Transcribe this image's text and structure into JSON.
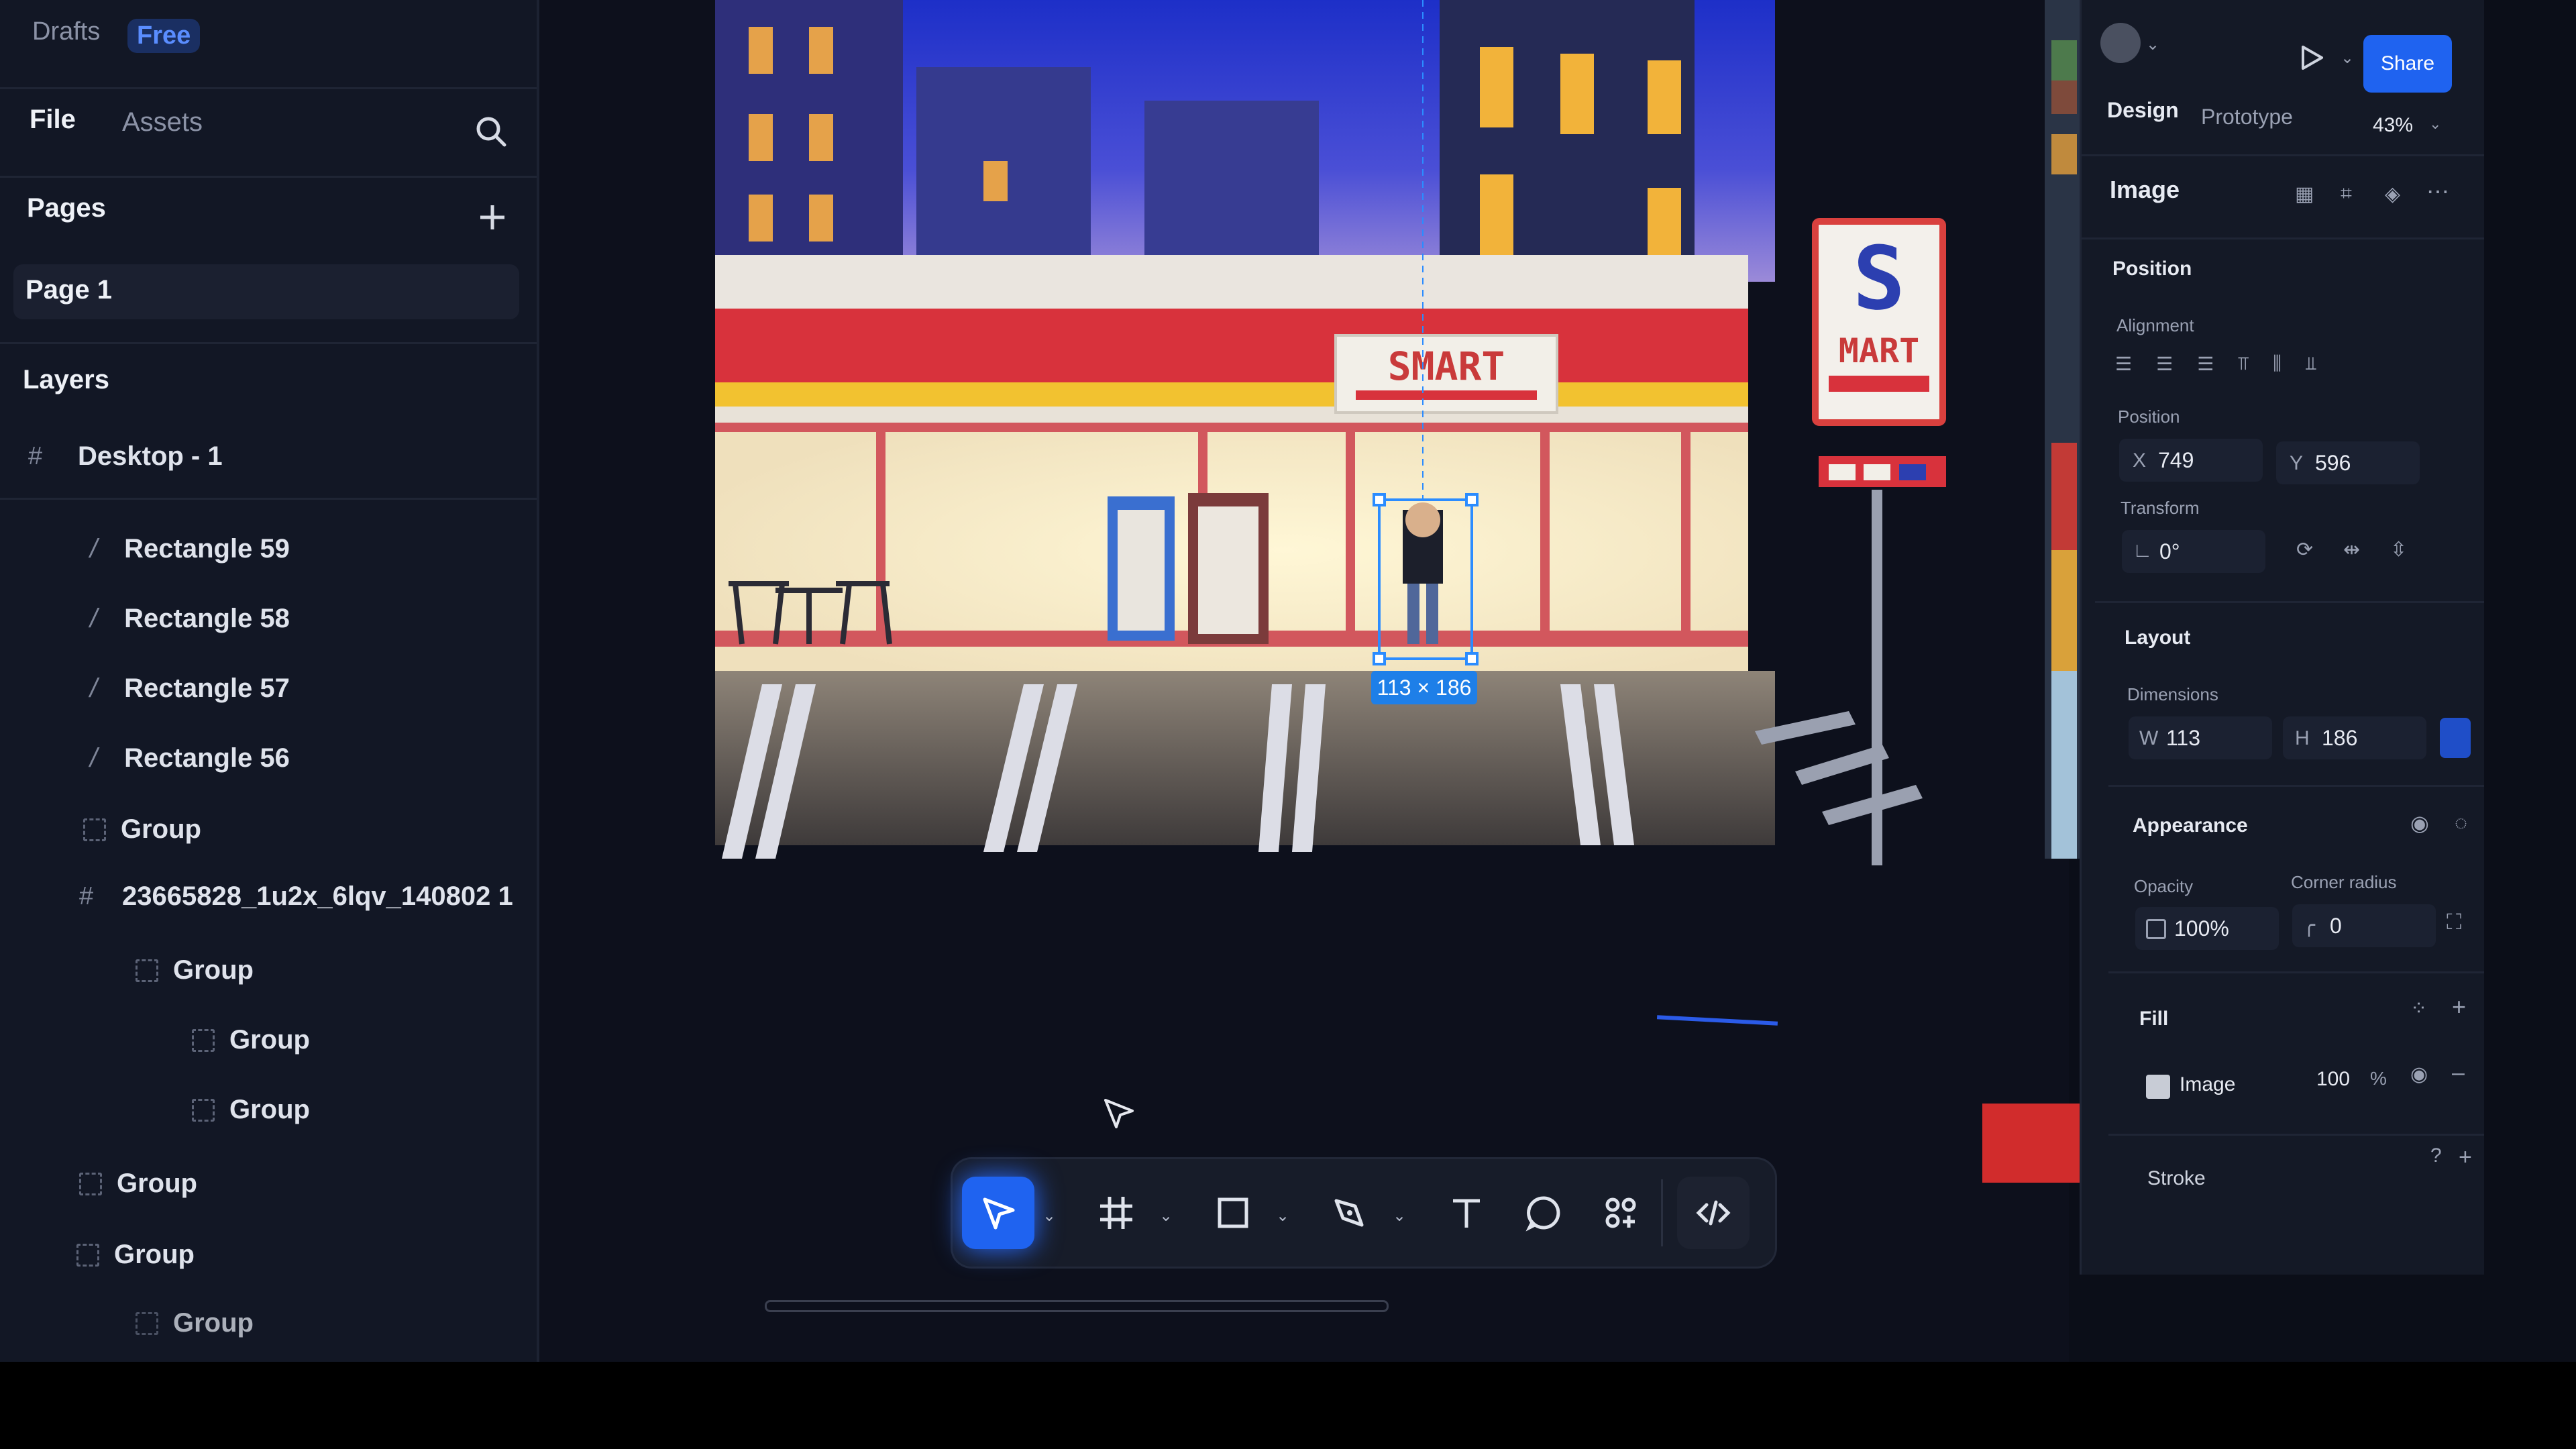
{
  "top": {
    "drafts": "Drafts",
    "plan_badge": "Free"
  },
  "left_tabs": {
    "file": "File",
    "assets": "Assets"
  },
  "pages": {
    "title": "Pages",
    "items": [
      "Page 1"
    ]
  },
  "layers": {
    "title": "Layers",
    "frame": "Desktop - 1",
    "items": [
      "Rectangle 59",
      "Rectangle 58",
      "Rectangle 57",
      "Rectangle 56",
      "Group",
      "23665828_1u2x_6lqv_140802 1",
      "Group",
      "Group",
      "Group",
      "Group",
      "Group",
      "Group"
    ]
  },
  "canvas": {
    "store_sign": "SMART",
    "pole_sign_s": "S",
    "pole_sign_text": "MART",
    "selection_size": "113 × 186"
  },
  "right": {
    "share": "Share",
    "tabs": {
      "design": "Design",
      "prototype": "Prototype"
    },
    "zoom": "43%",
    "section_title": "Image",
    "position": {
      "title": "Position",
      "alignment_label": "Alignment",
      "position_label": "Position",
      "x_label": "X",
      "x": "749",
      "y_label": "Y",
      "y": "596",
      "transform_label": "Transform",
      "rotation": "0°"
    },
    "layout": {
      "title": "Layout",
      "dimensions_label": "Dimensions",
      "w_label": "W",
      "w": "113",
      "h_label": "H",
      "h": "186"
    },
    "appearance": {
      "title": "Appearance",
      "opacity_label": "Opacity",
      "opacity": "100%",
      "corner_label": "Corner radius",
      "corner": "0"
    },
    "fill": {
      "title": "Fill",
      "type": "Image",
      "value": "100",
      "unit": "%"
    },
    "stroke": {
      "title": "Stroke"
    }
  },
  "colors": {
    "accent": "#1f63f0",
    "store_red": "#d8323c",
    "store_yellow": "#f2c230",
    "selection": "#2b8cff"
  },
  "icons": [
    "search-icon",
    "plus-icon",
    "frame-icon",
    "play-icon",
    "move-tool-icon",
    "frame-tool-icon",
    "rectangle-tool-icon",
    "pen-tool-icon",
    "text-tool-icon",
    "comment-tool-icon",
    "actions-icon",
    "dev-mode-icon"
  ]
}
